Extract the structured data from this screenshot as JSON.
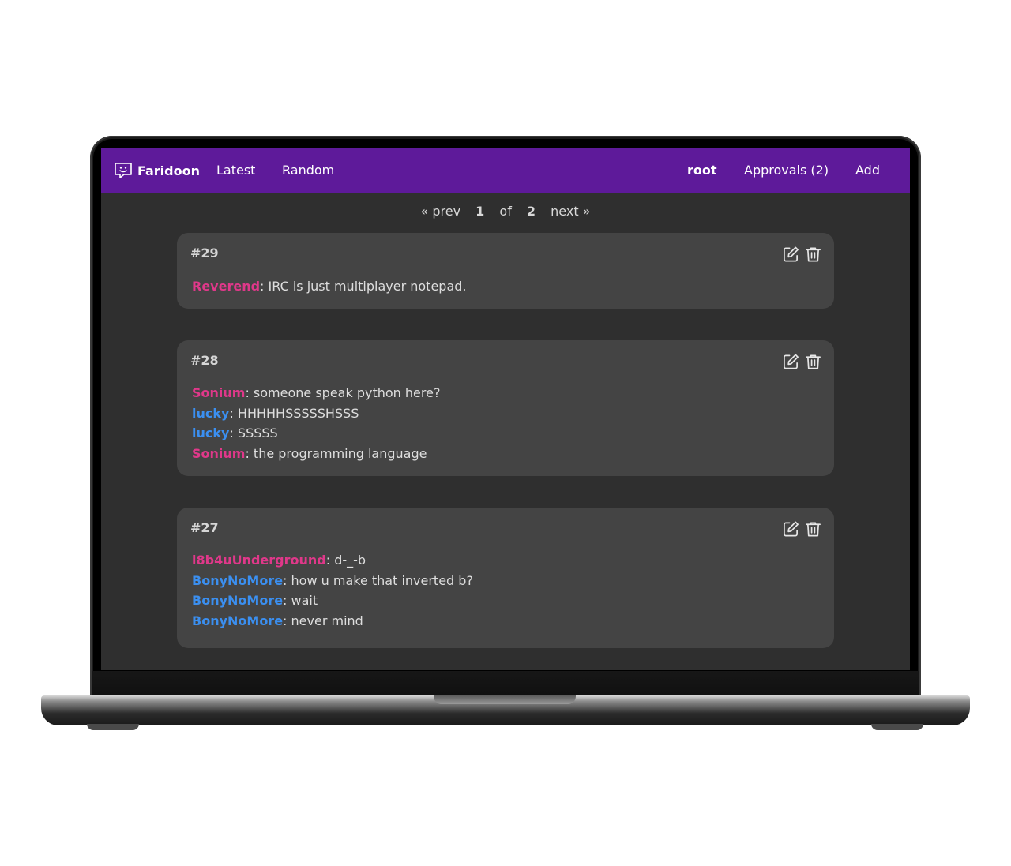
{
  "navbar": {
    "brand": "Faridoon",
    "links": [
      "Latest",
      "Random"
    ],
    "user": "root",
    "approvals": "Approvals (2)",
    "add": "Add",
    "background": "#5e1a9a"
  },
  "pager": {
    "prev": "« prev",
    "current": "1",
    "of": "of",
    "total": "2",
    "next": "next »"
  },
  "quotes": [
    {
      "id": "#29",
      "lines": [
        {
          "nick": "Reverend",
          "color": "pink",
          "text": ": IRC is just multiplayer notepad."
        }
      ]
    },
    {
      "id": "#28",
      "lines": [
        {
          "nick": "Sonium",
          "color": "pink",
          "text": ": someone speak python here?"
        },
        {
          "nick": "lucky",
          "color": "blue",
          "text": ": HHHHHSSSSSHSSS"
        },
        {
          "nick": "lucky",
          "color": "blue",
          "text": ": SSSSS"
        },
        {
          "nick": "Sonium",
          "color": "pink",
          "text": ": the programming language"
        }
      ]
    },
    {
      "id": "#27",
      "lines": [
        {
          "nick": "i8b4uUnderground",
          "color": "pink",
          "text": ": d-_-b"
        },
        {
          "nick": "BonyNoMore",
          "color": "blue",
          "text": ": how u make that inverted b?"
        },
        {
          "nick": "BonyNoMore",
          "color": "blue",
          "text": ": wait"
        },
        {
          "nick": "BonyNoMore",
          "color": "blue",
          "text": ": never mind"
        }
      ]
    }
  ],
  "icons": {
    "brand": "chat-smile-icon",
    "edit": "edit-icon",
    "delete": "trash-icon"
  },
  "colors": {
    "nick_pink": "#e0388a",
    "nick_blue": "#3b8ff0",
    "card": "#444444",
    "page": "#2f2f2f"
  }
}
